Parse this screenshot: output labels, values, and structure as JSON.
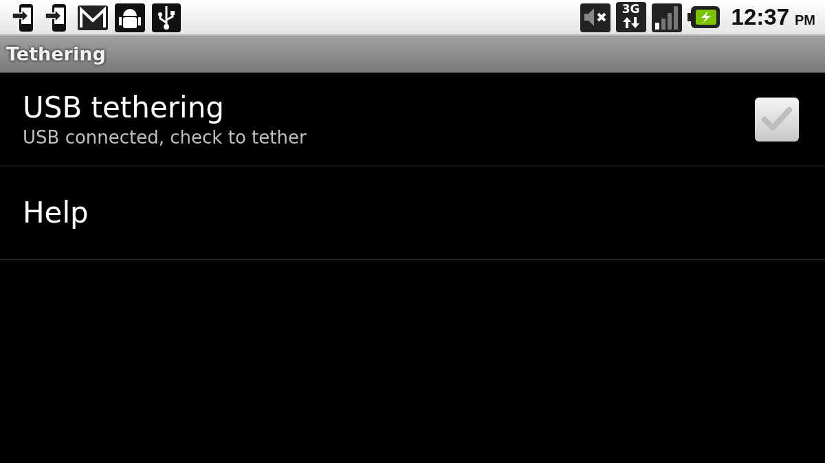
{
  "status_bar": {
    "network": "3G",
    "time": "12:37",
    "ampm": "PM"
  },
  "window": {
    "title": "Tethering"
  },
  "items": [
    {
      "kind": "checkbox",
      "title": "USB tethering",
      "summary": "USB connected, check to tether",
      "checked": false
    },
    {
      "kind": "plain",
      "title": "Help"
    }
  ]
}
